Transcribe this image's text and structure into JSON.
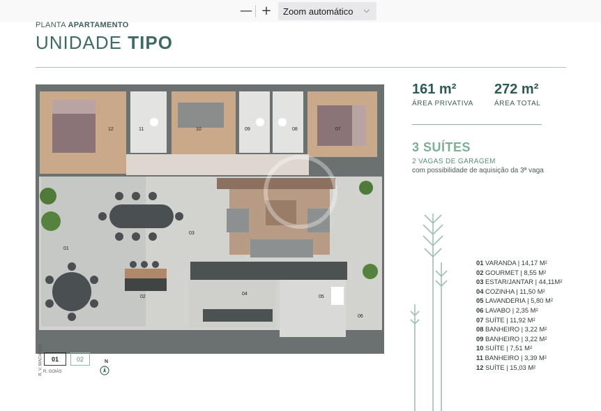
{
  "viewer": {
    "minus": "—",
    "plus": "+",
    "zoom": "Zoom automático"
  },
  "header": {
    "planta_light": "PLANTA ",
    "planta_bold": "APARTAMENTO",
    "title_light": "UNIDADE ",
    "title_bold": "TIPO"
  },
  "areas": {
    "privativa_value": "161 m²",
    "privativa_label": "ÁREA PRIVATIVA",
    "total_value": "272 m²",
    "total_label": "ÁREA TOTAL"
  },
  "features": {
    "suites": "3 SUÍTES",
    "vagas": "2 VAGAS DE GARAGEM",
    "possibilidade": "com possibilidade de aquisição da 3ª vaga"
  },
  "legend": [
    {
      "n": "01",
      "text": "VARANDA | 14,17 M²"
    },
    {
      "n": "02",
      "text": "GOURMET | 8,55  M²"
    },
    {
      "n": "03",
      "text": "ESTAR/JANTAR | 44,11M²"
    },
    {
      "n": "04",
      "text": "COZINHA | 11,50 M²"
    },
    {
      "n": "05",
      "text": "LAVANDERIA | 5,80 M²"
    },
    {
      "n": "06",
      "text": "LAVABO | 2,35 M²"
    },
    {
      "n": "07",
      "text": "SUÍTE | 11,92 M²"
    },
    {
      "n": "08",
      "text": "BANHEIRO | 3,22 M²"
    },
    {
      "n": "09",
      "text": "BANHEIRO | 3,22 M²"
    },
    {
      "n": "10",
      "text": "SUÍTE | 7,51 M²"
    },
    {
      "n": "11",
      "text": "BANHEIRO | 3,39 M²"
    },
    {
      "n": "12",
      "text": "SUÍTE | 15,03 M²"
    }
  ],
  "plan_labels": {
    "r01": "01",
    "r02": "02",
    "r03": "03",
    "r04": "04",
    "r05": "05",
    "r06": "06",
    "r07": "07",
    "r08": "08",
    "r09": "09",
    "r10": "10",
    "r11": "11",
    "r12": "12"
  },
  "orientation": {
    "box1": "01",
    "box2": "02",
    "street_vertical": "R. V. MACHADO",
    "street_horizontal": "R. GOIÁS",
    "north": "N"
  },
  "colors": {
    "accent": "#7fae97",
    "title": "#3d6b63",
    "floor_light": "#d2d2cf",
    "floor_wood": "#c9a98a",
    "walls": "#6b7071"
  }
}
